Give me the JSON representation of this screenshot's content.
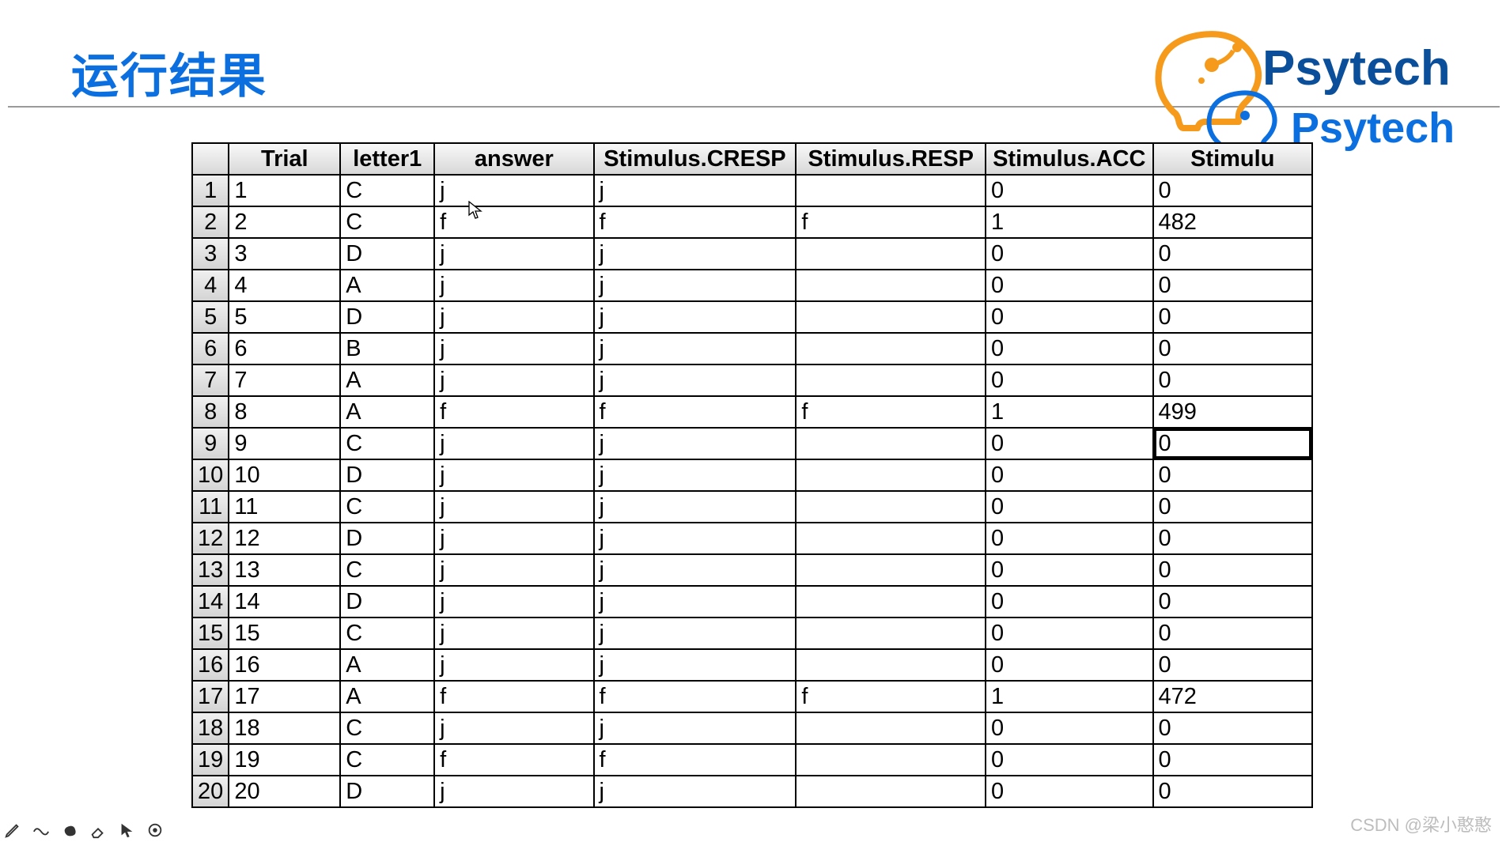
{
  "title": "运行结果",
  "logo_text_primary": "Psytech",
  "logo_text_secondary": "Psytech",
  "watermark": "CSDN @梁小憨憨",
  "columns": {
    "rownum": "",
    "trial": "Trial",
    "letter1": "letter1",
    "answer": "answer",
    "cresp": "Stimulus.CRESP",
    "resp": "Stimulus.RESP",
    "acc": "Stimulus.ACC",
    "rt": "Stimulu"
  },
  "selected_cell": {
    "row_index": 8,
    "col": "rt"
  },
  "rows": [
    {
      "n": "1",
      "trial": "1",
      "letter1": "C",
      "answer": "j",
      "cresp": "j",
      "resp": "",
      "acc": "0",
      "rt": "0"
    },
    {
      "n": "2",
      "trial": "2",
      "letter1": "C",
      "answer": "f",
      "cresp": "f",
      "resp": "f",
      "acc": "1",
      "rt": "482"
    },
    {
      "n": "3",
      "trial": "3",
      "letter1": "D",
      "answer": "j",
      "cresp": "j",
      "resp": "",
      "acc": "0",
      "rt": "0"
    },
    {
      "n": "4",
      "trial": "4",
      "letter1": "A",
      "answer": "j",
      "cresp": "j",
      "resp": "",
      "acc": "0",
      "rt": "0"
    },
    {
      "n": "5",
      "trial": "5",
      "letter1": "D",
      "answer": "j",
      "cresp": "j",
      "resp": "",
      "acc": "0",
      "rt": "0"
    },
    {
      "n": "6",
      "trial": "6",
      "letter1": "B",
      "answer": "j",
      "cresp": "j",
      "resp": "",
      "acc": "0",
      "rt": "0"
    },
    {
      "n": "7",
      "trial": "7",
      "letter1": "A",
      "answer": "j",
      "cresp": "j",
      "resp": "",
      "acc": "0",
      "rt": "0"
    },
    {
      "n": "8",
      "trial": "8",
      "letter1": "A",
      "answer": "f",
      "cresp": "f",
      "resp": "f",
      "acc": "1",
      "rt": "499"
    },
    {
      "n": "9",
      "trial": "9",
      "letter1": "C",
      "answer": "j",
      "cresp": "j",
      "resp": "",
      "acc": "0",
      "rt": "0"
    },
    {
      "n": "10",
      "trial": "10",
      "letter1": "D",
      "answer": "j",
      "cresp": "j",
      "resp": "",
      "acc": "0",
      "rt": "0"
    },
    {
      "n": "11",
      "trial": "11",
      "letter1": "C",
      "answer": "j",
      "cresp": "j",
      "resp": "",
      "acc": "0",
      "rt": "0"
    },
    {
      "n": "12",
      "trial": "12",
      "letter1": "D",
      "answer": "j",
      "cresp": "j",
      "resp": "",
      "acc": "0",
      "rt": "0"
    },
    {
      "n": "13",
      "trial": "13",
      "letter1": "C",
      "answer": "j",
      "cresp": "j",
      "resp": "",
      "acc": "0",
      "rt": "0"
    },
    {
      "n": "14",
      "trial": "14",
      "letter1": "D",
      "answer": "j",
      "cresp": "j",
      "resp": "",
      "acc": "0",
      "rt": "0"
    },
    {
      "n": "15",
      "trial": "15",
      "letter1": "C",
      "answer": "j",
      "cresp": "j",
      "resp": "",
      "acc": "0",
      "rt": "0"
    },
    {
      "n": "16",
      "trial": "16",
      "letter1": "A",
      "answer": "j",
      "cresp": "j",
      "resp": "",
      "acc": "0",
      "rt": "0"
    },
    {
      "n": "17",
      "trial": "17",
      "letter1": "A",
      "answer": "f",
      "cresp": "f",
      "resp": "f",
      "acc": "1",
      "rt": "472"
    },
    {
      "n": "18",
      "trial": "18",
      "letter1": "C",
      "answer": "j",
      "cresp": "j",
      "resp": "",
      "acc": "0",
      "rt": "0"
    },
    {
      "n": "19",
      "trial": "19",
      "letter1": "C",
      "answer": "f",
      "cresp": "f",
      "resp": "",
      "acc": "0",
      "rt": "0"
    },
    {
      "n": "20",
      "trial": "20",
      "letter1": "D",
      "answer": "j",
      "cresp": "j",
      "resp": "",
      "acc": "0",
      "rt": "0"
    }
  ],
  "tools": {
    "pencil": "pencil-icon",
    "wave": "wave-icon",
    "blob": "blob-icon",
    "eraser": "eraser-icon",
    "pointer": "pointer-icon",
    "record": "record-icon"
  }
}
